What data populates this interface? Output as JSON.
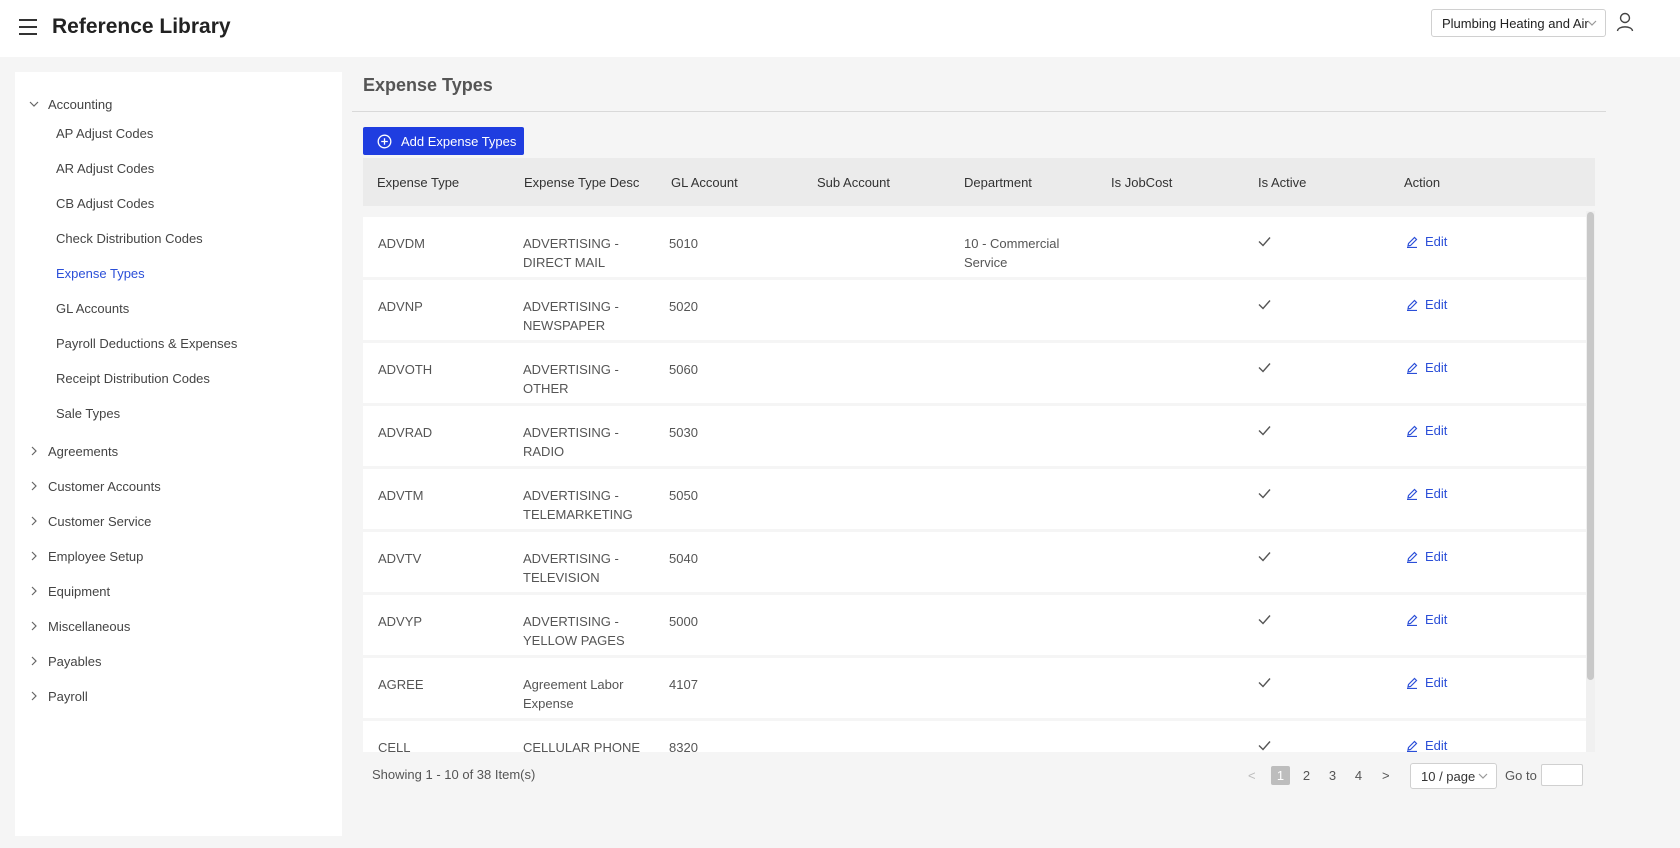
{
  "header": {
    "title": "Reference Library",
    "company": "Plumbing Heating and Air"
  },
  "sidebar": {
    "groups": [
      {
        "label": "Accounting",
        "expanded": true,
        "items": [
          "AP Adjust Codes",
          "AR Adjust Codes",
          "CB Adjust Codes",
          "Check Distribution Codes",
          "Expense Types",
          "GL Accounts",
          "Payroll Deductions & Expenses",
          "Receipt Distribution Codes",
          "Sale Types"
        ]
      },
      {
        "label": "Agreements"
      },
      {
        "label": "Customer Accounts"
      },
      {
        "label": "Customer Service"
      },
      {
        "label": "Employee Setup"
      },
      {
        "label": "Equipment"
      },
      {
        "label": "Miscellaneous"
      },
      {
        "label": "Payables"
      },
      {
        "label": "Payroll"
      }
    ],
    "active_item": "Expense Types"
  },
  "main": {
    "title": "Expense Types",
    "add_button": "Add Expense Types",
    "columns": [
      "Expense Type",
      "Expense Type Desc",
      "GL Account",
      "Sub Account",
      "Department",
      "Is JobCost",
      "Is Active",
      "Action"
    ],
    "rows": [
      {
        "type": "ADVDM",
        "desc1": "ADVERTISING -",
        "desc2": "DIRECT MAIL",
        "gl": "5010",
        "sub": "",
        "dept1": "10 - Commercial",
        "dept2": "Service",
        "jobcost": false,
        "active": true,
        "action": "Edit"
      },
      {
        "type": "ADVNP",
        "desc1": "ADVERTISING -",
        "desc2": "NEWSPAPER",
        "gl": "5020",
        "sub": "",
        "dept1": "",
        "dept2": "",
        "jobcost": false,
        "active": true,
        "action": "Edit"
      },
      {
        "type": "ADVOTH",
        "desc1": "ADVERTISING -",
        "desc2": "OTHER",
        "gl": "5060",
        "sub": "",
        "dept1": "",
        "dept2": "",
        "jobcost": false,
        "active": true,
        "action": "Edit"
      },
      {
        "type": "ADVRAD",
        "desc1": "ADVERTISING -",
        "desc2": "RADIO",
        "gl": "5030",
        "sub": "",
        "dept1": "",
        "dept2": "",
        "jobcost": false,
        "active": true,
        "action": "Edit"
      },
      {
        "type": "ADVTM",
        "desc1": "ADVERTISING -",
        "desc2": "TELEMARKETING",
        "gl": "5050",
        "sub": "",
        "dept1": "",
        "dept2": "",
        "jobcost": false,
        "active": true,
        "action": "Edit"
      },
      {
        "type": "ADVTV",
        "desc1": "ADVERTISING -",
        "desc2": "TELEVISION",
        "gl": "5040",
        "sub": "",
        "dept1": "",
        "dept2": "",
        "jobcost": false,
        "active": true,
        "action": "Edit"
      },
      {
        "type": "ADVYP",
        "desc1": "ADVERTISING -",
        "desc2": "YELLOW PAGES",
        "gl": "5000",
        "sub": "",
        "dept1": "",
        "dept2": "",
        "jobcost": false,
        "active": true,
        "action": "Edit"
      },
      {
        "type": "AGREE",
        "desc1": "Agreement Labor",
        "desc2": "Expense",
        "gl": "4107",
        "sub": "",
        "dept1": "",
        "dept2": "",
        "jobcost": false,
        "active": true,
        "action": "Edit"
      },
      {
        "type": "CELL",
        "desc1": "CELLULAR PHONE",
        "desc2": "",
        "gl": "8320",
        "sub": "",
        "dept1": "",
        "dept2": "",
        "jobcost": false,
        "active": true,
        "action": "Edit"
      }
    ]
  },
  "pagination": {
    "showing": "Showing 1 - 10 of 38 Item(s)",
    "prev": "<",
    "pages": [
      "1",
      "2",
      "3",
      "4"
    ],
    "current": "1",
    "next": ">",
    "page_size": "10 / page",
    "goto_label": "Go to"
  },
  "colors": {
    "accent": "#1f3de0",
    "link": "#2b4fd8"
  }
}
